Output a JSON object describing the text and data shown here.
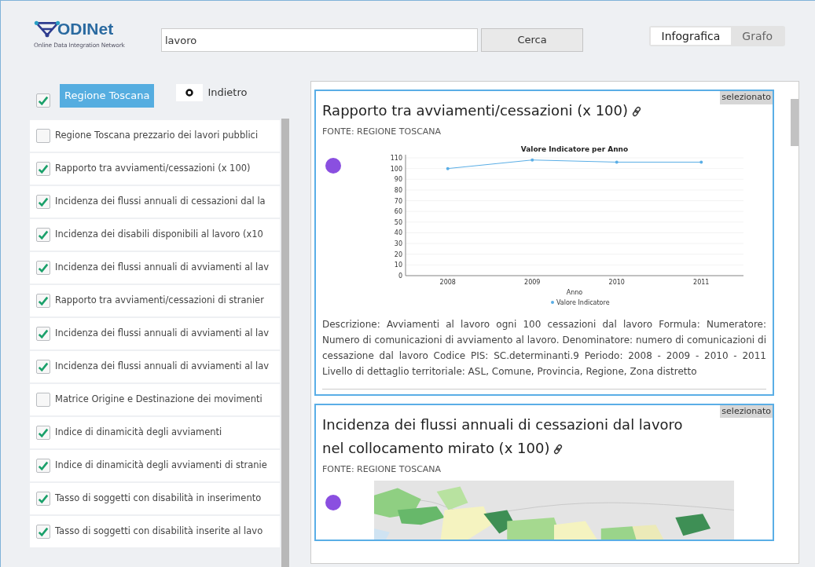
{
  "logo": {
    "name": "ODINet",
    "tagline": "Online Data Integration Network"
  },
  "search": {
    "value": "lavoro",
    "button": "Cerca"
  },
  "view_tabs": [
    {
      "label": "Infografica",
      "selected": true
    },
    {
      "label": "Grafo",
      "selected": false
    }
  ],
  "sidebar": {
    "all_checked": true,
    "region_button": "Regione Toscana",
    "back_button": "Indietro",
    "items": [
      {
        "label": "Regione Toscana prezzario dei lavori pubblici",
        "checked": false
      },
      {
        "label": "Rapporto tra avviamenti/cessazioni (x 100)",
        "checked": true
      },
      {
        "label": "Incidenza dei flussi annuali di cessazioni dal la",
        "checked": true
      },
      {
        "label": "Incidenza dei disabili disponibili al lavoro (x10",
        "checked": true
      },
      {
        "label": "Incidenza dei flussi annuali di avviamenti al lav",
        "checked": true
      },
      {
        "label": "Rapporto tra avviamenti/cessazioni di stranier",
        "checked": true
      },
      {
        "label": "Incidenza dei flussi annuali di avviamenti al lav",
        "checked": true
      },
      {
        "label": "Incidenza dei flussi annuali di avviamenti al lav",
        "checked": true
      },
      {
        "label": "Matrice Origine e Destinazione dei movimenti",
        "checked": false
      },
      {
        "label": "Indice di dinamicità degli avviamenti",
        "checked": true
      },
      {
        "label": "Indice di dinamicità degli avviamenti di stranie",
        "checked": true
      },
      {
        "label": "Tasso di soggetti con disabilità in inserimento",
        "checked": true
      },
      {
        "label": "Tasso di soggetti con disabilità inserite al lavo",
        "checked": true
      }
    ]
  },
  "cards": [
    {
      "kind": "chart",
      "selected": true,
      "badge": "selezionato",
      "title": "Rapporto tra avviamenti/cessazioni (x 100)",
      "source": "FONTE: REGIONE TOSCANA",
      "chart_data": {
        "type": "line",
        "title": "Valore Indicatore per Anno",
        "xlabel": "Anno",
        "categories": [
          "2008",
          "2009",
          "2010",
          "2011"
        ],
        "series": [
          {
            "name": "Valore Indicatore",
            "color": "#5aaee6",
            "values": [
              100,
              108,
              106,
              106
            ]
          }
        ],
        "ylim": [
          0,
          110
        ],
        "grid": true,
        "yticks": [
          0,
          10,
          20,
          30,
          40,
          50,
          60,
          70,
          80,
          90,
          100,
          110
        ]
      },
      "description": "Descrizione: Avviamenti al lavoro ogni 100 cessazioni dal lavoro Formula: Numeratore: Numero di comunicazioni di avviamento al lavoro. Denominatore: numero di comunicazioni di cessazione dal lavoro Codice PIS: SC.determinanti.9 Periodo: 2008 - 2009 - 2010 - 2011 Livello di dettaglio territoriale: ASL, Comune, Provincia, Regione, Zona distretto"
    },
    {
      "kind": "map",
      "selected": true,
      "badge": "selezionato",
      "title": "Incidenza dei flussi annuali di cessazioni dal lavoro nel collocamento mirato (x 100)",
      "source": "FONTE: REGIONE TOSCANA"
    }
  ]
}
